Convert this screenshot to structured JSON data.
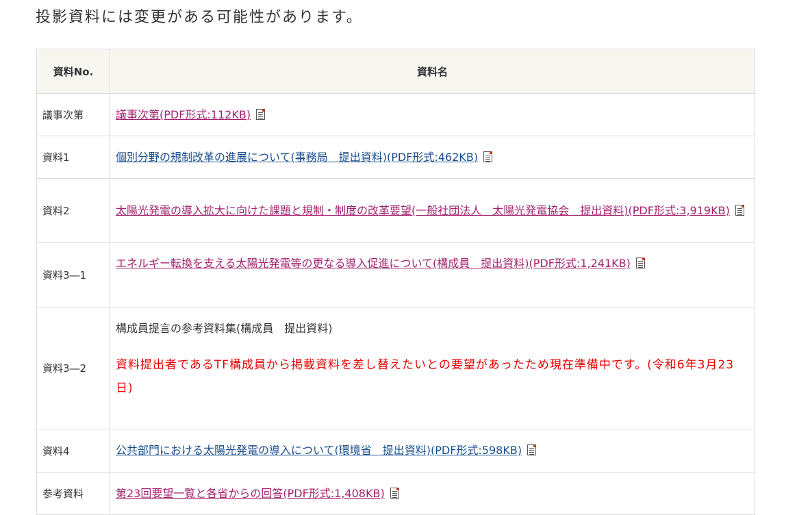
{
  "notice": "投影資料には変更がある可能性があります。",
  "table": {
    "headers": {
      "no": "資料No.",
      "name": "資料名"
    },
    "rows": [
      {
        "no": "議事次第",
        "link": "議事次第(PDF形式:112KB)",
        "visited": true
      },
      {
        "no": "資料1",
        "link": "個別分野の規制改革の進展について(事務局　提出資料)(PDF形式:462KB)",
        "visited": false
      },
      {
        "no": "資料2",
        "link": "太陽光発電の導入拡大に向けた課題と規制・制度の改革要望(一般社団法人　太陽光発電協会　提出資料)(PDF形式:3,919KB)",
        "visited": true
      },
      {
        "no": "資料3―1",
        "link": "エネルギー転換を支える太陽光発電等の更なる導入促進について(構成員　提出資料)(PDF形式:1,241KB)",
        "visited": true
      },
      {
        "no": "資料3―2",
        "text": "構成員提言の参考資料集(構成員　提出資料)",
        "warning": "資料提出者であるTF構成員から掲載資料を差し替えたいとの要望があったため現在準備中です。(令和6年3月23日)"
      },
      {
        "no": "資料4",
        "link": "公共部門における太陽光発電の導入について(環境省　提出資料)(PDF形式:598KB)",
        "visited": false
      },
      {
        "no": "参考資料",
        "link": "第23回要望一覧と各省からの回答(PDF形式:1,408KB)",
        "visited": true
      }
    ]
  },
  "icons": {
    "pdf": "pdf-document-icon"
  },
  "colors": {
    "visited_link": "#a3226f",
    "link": "#1a4f8f",
    "warning": "#e60000",
    "header_bg": "#f7f6f1"
  }
}
